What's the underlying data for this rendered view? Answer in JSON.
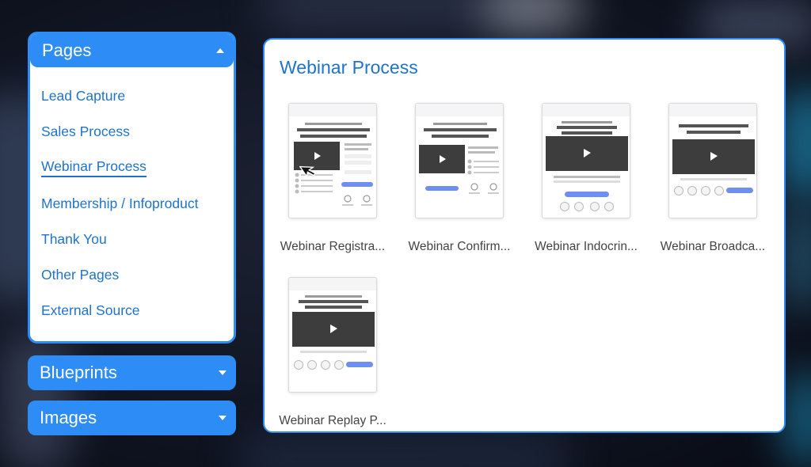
{
  "colors": {
    "accent": "#2d8cf5",
    "link": "#1f73cc",
    "thumb_button": "#6e8ff0",
    "thumb_video": "#3d3d3d"
  },
  "sidebar": {
    "pages": {
      "label": "Pages",
      "expanded": true,
      "items": [
        {
          "label": "Lead Capture",
          "active": false
        },
        {
          "label": "Sales Process",
          "active": false
        },
        {
          "label": "Webinar Process",
          "active": true
        },
        {
          "label": "Membership / Infoproduct",
          "active": false
        },
        {
          "label": "Thank You",
          "active": false
        },
        {
          "label": "Other Pages",
          "active": false
        },
        {
          "label": "External Source",
          "active": false
        }
      ]
    },
    "blueprints": {
      "label": "Blueprints",
      "expanded": false
    },
    "images": {
      "label": "Images",
      "expanded": false
    }
  },
  "main": {
    "title": "Webinar Process",
    "templates": [
      {
        "label": "Webinar Registra..."
      },
      {
        "label": "Webinar Confirm..."
      },
      {
        "label": "Webinar Indocrin..."
      },
      {
        "label": "Webinar Broadca..."
      },
      {
        "label": "Webinar Replay P..."
      }
    ]
  },
  "icons": {
    "caret_up": "caret-up-icon",
    "caret_down": "caret-down-icon",
    "play": "play-icon",
    "cursor": "mouse-pointer-icon"
  }
}
